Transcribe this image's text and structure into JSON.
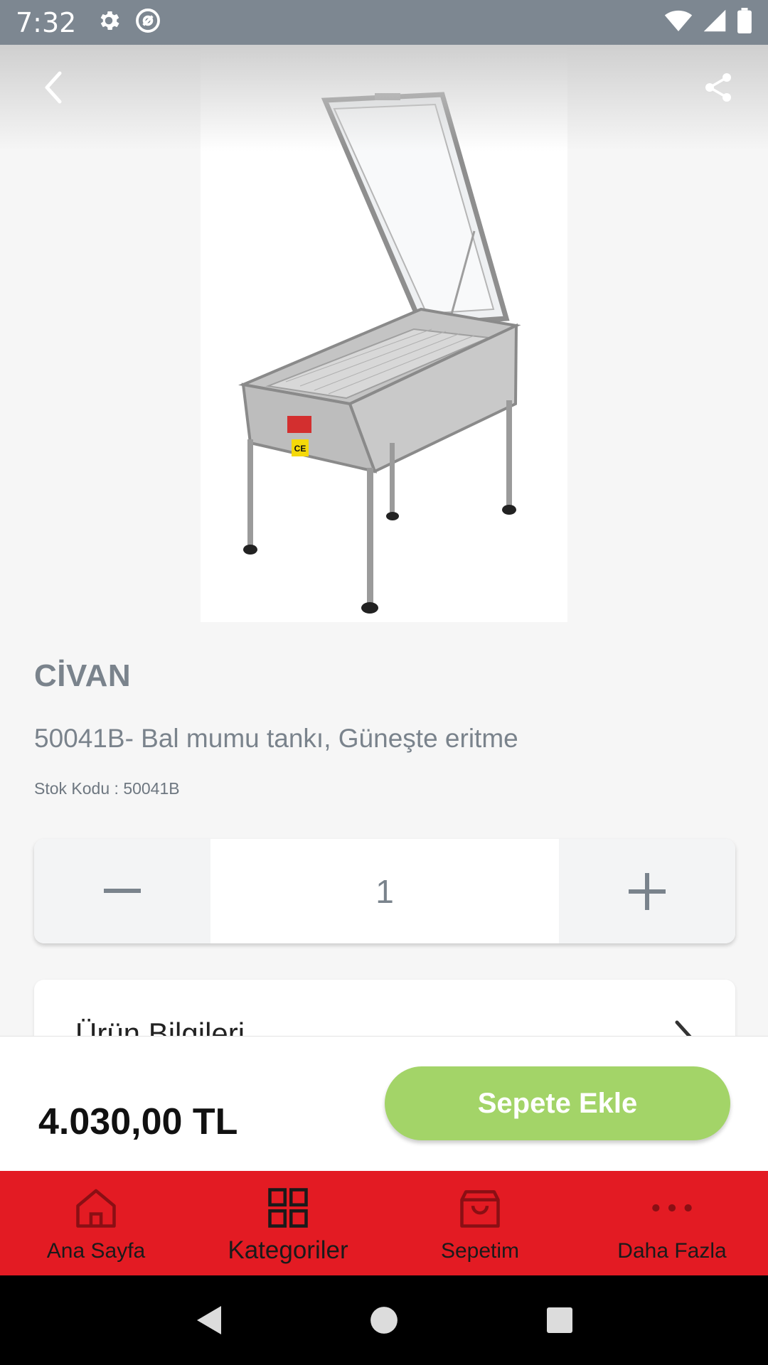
{
  "status_bar": {
    "time": "7:32",
    "icons": [
      "settings-icon",
      "at-sign-icon",
      "wifi-icon",
      "signal-icon",
      "battery-icon"
    ]
  },
  "header": {
    "back_icon": "chevron-left-icon",
    "share_icon": "share-icon"
  },
  "product": {
    "brand": "CİVAN",
    "name": "50041B- Bal mumu tankı, Güneşte eritme",
    "stock_label": "Stok Kodu : ",
    "stock_code": "50041B",
    "image_label": "CIVAN"
  },
  "quantity": {
    "value": "1",
    "decrement_icon": "minus-icon",
    "increment_icon": "plus-icon"
  },
  "info_section": {
    "title": "Ürün Bilgileri",
    "chevron_icon": "chevron-right-icon"
  },
  "cart_bar": {
    "price": "4.030,00 TL",
    "add_button_label": "Sepete Ekle"
  },
  "bottom_nav": {
    "items": [
      {
        "label": "Ana Sayfa",
        "icon": "home-icon"
      },
      {
        "label": "Kategoriler",
        "icon": "grid-icon"
      },
      {
        "label": "Sepetim",
        "icon": "shopping-bag-icon"
      },
      {
        "label": "Daha Fazla",
        "icon": "more-dots-icon"
      }
    ]
  },
  "system_nav": {
    "icons": [
      "back-triangle-icon",
      "home-circle-icon",
      "recents-square-icon"
    ]
  },
  "colors": {
    "status_bar": "#7d8791",
    "accent_red": "#e31b23",
    "add_button_green": "#a3d468",
    "muted_text": "#7a838c"
  }
}
